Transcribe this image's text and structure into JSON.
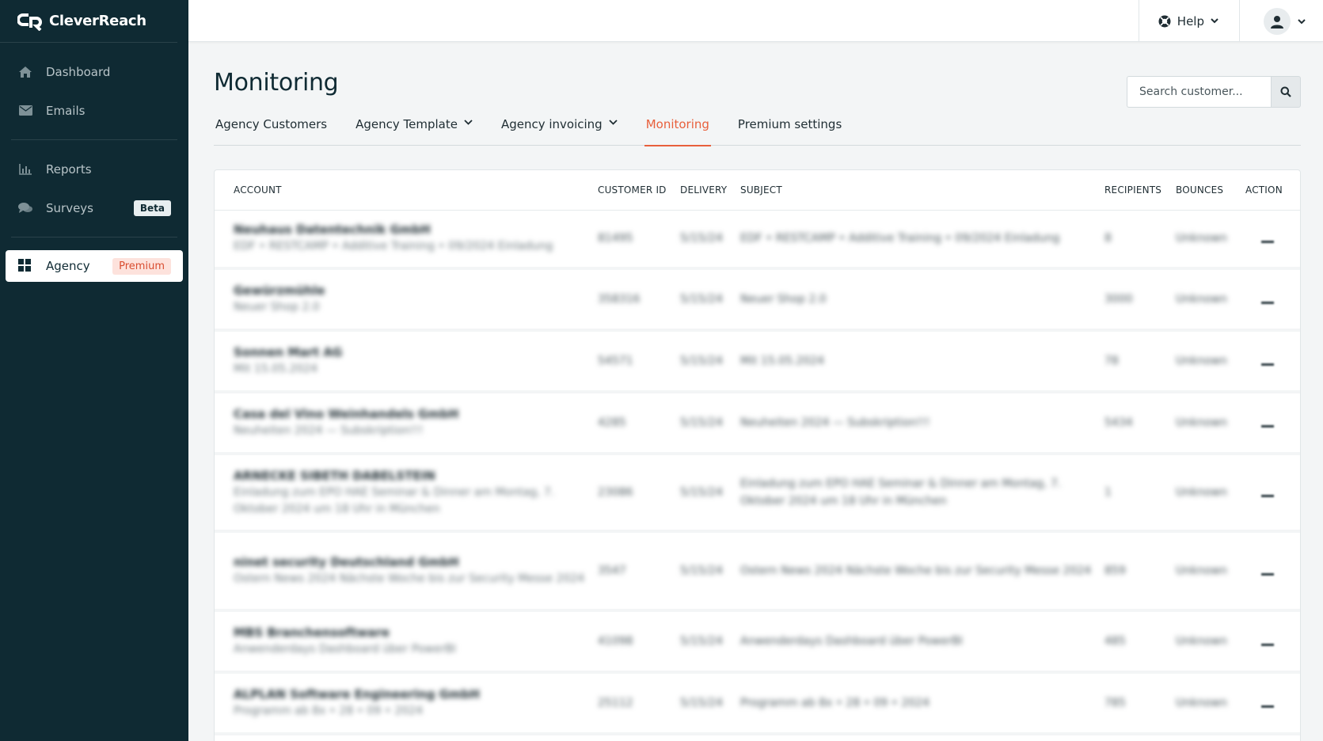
{
  "brand": {
    "name": "CleverReach"
  },
  "sidebar": {
    "items": [
      {
        "label": "Dashboard",
        "icon": "home-icon"
      },
      {
        "label": "Emails",
        "icon": "envelope-icon"
      },
      {
        "label": "Reports",
        "icon": "bar-chart-icon"
      },
      {
        "label": "Surveys",
        "icon": "chat-bubbles-icon",
        "badge": "Beta"
      },
      {
        "label": "Agency",
        "icon": "grid-icon",
        "badge": "Premium",
        "active": true
      }
    ]
  },
  "topbar": {
    "help_label": "Help"
  },
  "page": {
    "title": "Monitoring",
    "search_placeholder": "Search customer..."
  },
  "tabs": [
    {
      "label": "Agency Customers",
      "dropdown": false
    },
    {
      "label": "Agency Template",
      "dropdown": true
    },
    {
      "label": "Agency invoicing",
      "dropdown": true
    },
    {
      "label": "Monitoring",
      "dropdown": false,
      "active": true
    },
    {
      "label": "Premium settings",
      "dropdown": false
    }
  ],
  "table": {
    "headers": [
      "ACCOUNT",
      "CUSTOMER ID",
      "DELIVERY",
      "SUBJECT",
      "RECIPIENTS",
      "BOUNCES",
      "ACTION"
    ],
    "rows": [
      {
        "account": "Neuhaus Datentechnik GmbH",
        "account_sub": "EDF • RESTCAMP • Additive Training • 09/2024 Einladung",
        "customer_id": "81495",
        "delivery": "5/15/24",
        "subject": "EDF • RESTCAMP • Additive Training • 09/2024 Einladung",
        "recipients": "8",
        "bounces": "Unknown"
      },
      {
        "account": "Gewürzmühle",
        "account_sub": "Neuer Shop 2.0",
        "customer_id": "358316",
        "delivery": "5/15/24",
        "subject": "Neuer Shop 2.0",
        "recipients": "3000",
        "bounces": "Unknown"
      },
      {
        "account": "Sonnen Mart AG",
        "account_sub": "Mit 15.05.2024",
        "customer_id": "54571",
        "delivery": "5/15/24",
        "subject": "Mit 15.05.2024",
        "recipients": "78",
        "bounces": "Unknown"
      },
      {
        "account": "Casa del Vino Weinhandels GmbH",
        "account_sub": "Neuheiten 2024 — Subskription!!!",
        "customer_id": "4285",
        "delivery": "5/15/24",
        "subject": "Neuheiten 2024 — Subskription!!!",
        "recipients": "5434",
        "bounces": "Unknown"
      },
      {
        "account": "ARNECKE SIBETH DABELSTEIN",
        "account_sub": "Einladung zum EPO HAE Seminar & Dinner am Montag, 7. Oktober 2024 um 18 Uhr in München",
        "customer_id": "23086",
        "delivery": "5/15/24",
        "subject": "Einladung zum EPO HAE Seminar & Dinner am Montag, 7. Oktober 2024 um 18 Uhr in München",
        "recipients": "1",
        "bounces": "Unknown"
      },
      {
        "account": "ninet security Deutschland GmbH",
        "account_sub": "Ostern News 2024 Nächste Woche bis zur Security Messe 2024",
        "customer_id": "3547",
        "delivery": "5/15/24",
        "subject": "Ostern News 2024 Nächste Woche bis zur Security Messe 2024",
        "recipients": "859",
        "bounces": "Unknown"
      },
      {
        "account": "MBS Branchensoftware",
        "account_sub": "Anwenderdays Dashboard über PowerBI",
        "customer_id": "41098",
        "delivery": "5/15/24",
        "subject": "Anwenderdays Dashboard über PowerBI",
        "recipients": "485",
        "bounces": "Unknown"
      },
      {
        "account": "ALPLAN Software Engineering GmbH",
        "account_sub": "Programm ab 8x • 28 • 09 • 2024",
        "customer_id": "25112",
        "delivery": "5/15/24",
        "subject": "Programm ab 8x • 28 • 09 • 2024",
        "recipients": "785",
        "bounces": "Unknown"
      }
    ]
  }
}
